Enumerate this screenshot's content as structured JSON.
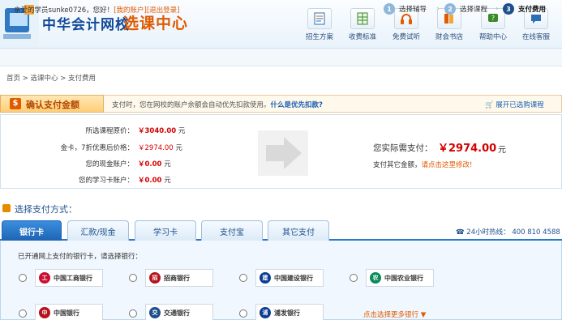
{
  "header": {
    "logo_text": "中华会计网校",
    "logo_sub": "选课中心",
    "nav": [
      {
        "label": "招生方案",
        "icon": "enroll-doc-icon"
      },
      {
        "label": "收费标准",
        "icon": "fee-table-icon"
      },
      {
        "label": "免费试听",
        "icon": "headphones-icon"
      },
      {
        "label": "财会书店",
        "icon": "bookstore-icon"
      },
      {
        "label": "帮助中心",
        "icon": "help-icon"
      },
      {
        "label": "在线客服",
        "icon": "chat-icon"
      }
    ]
  },
  "userbar": {
    "greeting": "亲爱的学员sunke0726，您好！",
    "my_account": "[我的账户]",
    "logout": "[退出登录]",
    "steps": [
      {
        "num": "1",
        "label": "选择辅导"
      },
      {
        "num": "2",
        "label": "选择课程"
      },
      {
        "num": "3",
        "label": "支付费用"
      }
    ]
  },
  "breadcrumb": "首页 > 选课中心 > 支付费用",
  "confirm": {
    "title": "确认支付金额",
    "note": "支付时，您在网校的账户余额会自动优先扣款使用。",
    "note_link": "什么是优先扣款?",
    "expand": "展开已选购课程"
  },
  "summary": {
    "rows": [
      {
        "label": "所选课程原价：",
        "value": "￥3040.00",
        "unit": "元"
      },
      {
        "label": "金卡，7折优惠后价格：",
        "value": "￥2974.00",
        "unit": "元"
      },
      {
        "label": "您的现金账户：",
        "value": "￥0.00",
        "unit": "元"
      },
      {
        "label": "您的学习卡账户：",
        "value": "￥0.00",
        "unit": "元"
      }
    ],
    "total_label": "您实际需支付：",
    "total_value": "￥2974.00",
    "total_unit": "元",
    "other_text": "支付其它金额，",
    "other_link": "请点击这里修改!"
  },
  "payment": {
    "title": "选择支付方式：",
    "tabs": [
      "银行卡",
      "汇款/现金",
      "学习卡",
      "支付宝",
      "其它支付"
    ],
    "hotline": "24小时热线：  400 810 4588",
    "hint": "已开通网上支付的银行卡，请选择银行：",
    "banks": [
      {
        "name": "中国工商银行",
        "color": "#c8102e"
      },
      {
        "name": "招商银行",
        "color": "#b5121b"
      },
      {
        "name": "中国建设银行",
        "color": "#0a3d91"
      },
      {
        "name": "中国农业银行",
        "color": "#0b8a5b"
      },
      {
        "name": "中国银行",
        "color": "#b5121b"
      },
      {
        "name": "交通银行",
        "color": "#1d4f8c"
      },
      {
        "name": "浦发银行",
        "color": "#0a3d91"
      }
    ],
    "more": "点击选择更多银行"
  }
}
